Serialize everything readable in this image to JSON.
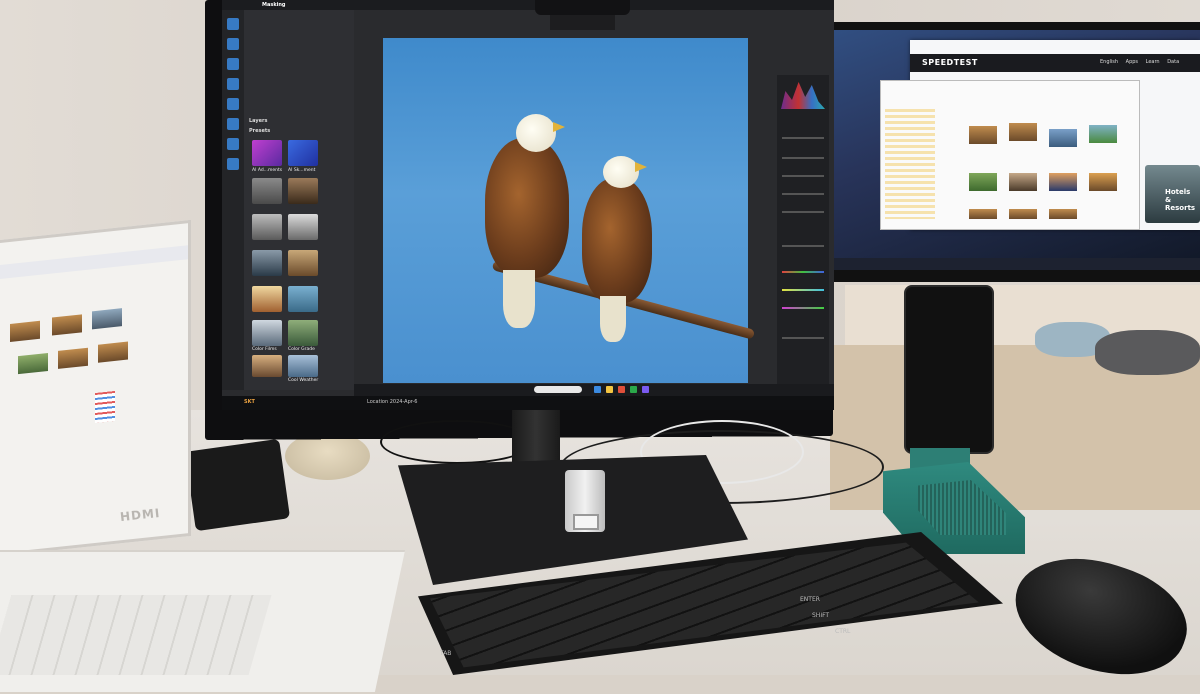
{
  "scene": {
    "description_colors": {
      "wall": "#e2dcd5",
      "desk": "#e7e3de",
      "sky": "#4a90cf",
      "accent_teal": "#2f8a7f"
    }
  },
  "main_monitor": {
    "app_menu": [
      "Masking"
    ],
    "panel_labels": {
      "layers": "Layers",
      "presets": "Presets"
    },
    "preset_labels": [
      "AI Ad...ments",
      "AI Sk...ment",
      "Color Films",
      "Color Grade",
      "Cool Weather"
    ],
    "status_bar": "Location 2024-Apr-6",
    "bottom_left": "SKT"
  },
  "right_monitor": {
    "browser_header": "SPEEDTEST",
    "nav_items": [
      "English",
      "Apps",
      "Learn",
      "Data"
    ],
    "promo_text": [
      "Hotels",
      "& Resorts"
    ]
  },
  "laptop": {
    "brand_text": "HDMI"
  },
  "keyboard": {
    "key_labels": [
      "TAB",
      "ENTER",
      "SHIFT",
      "CTRL"
    ]
  }
}
